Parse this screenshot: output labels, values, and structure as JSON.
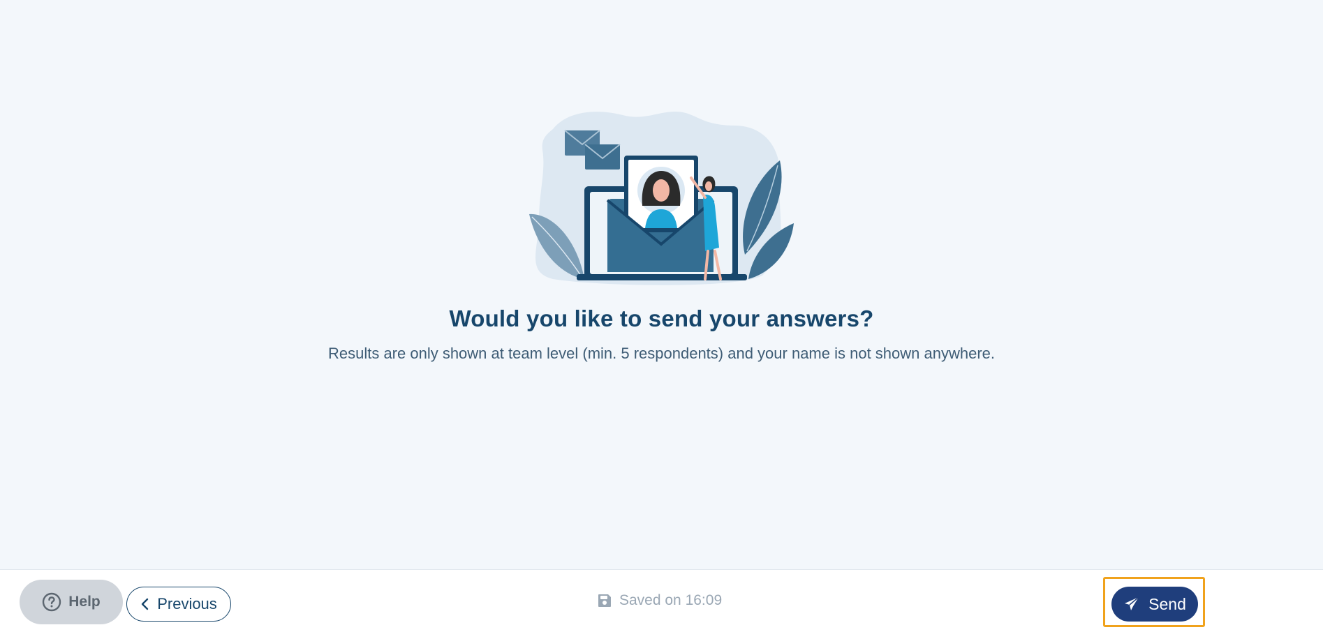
{
  "main": {
    "title": "Would you like to send your answers?",
    "subtitle": "Results are only shown at team level (min. 5 respondents) and your name is not shown anywhere.",
    "illustration_icon": "envelope-person-illustration"
  },
  "footer": {
    "help_label": "Help",
    "help_icon": "question-circle-icon",
    "previous_label": "Previous",
    "previous_icon": "chevron-left-icon",
    "saved_text": "Saved on 16:09",
    "saved_icon": "floppy-disk-icon",
    "send_label": "Send",
    "send_icon": "paper-plane-icon"
  },
  "colors": {
    "background": "#f3f7fb",
    "title": "#17466b",
    "send_button": "#1f3e7c",
    "focus_outline": "#f0a21c",
    "help_button": "#d0d5db"
  }
}
